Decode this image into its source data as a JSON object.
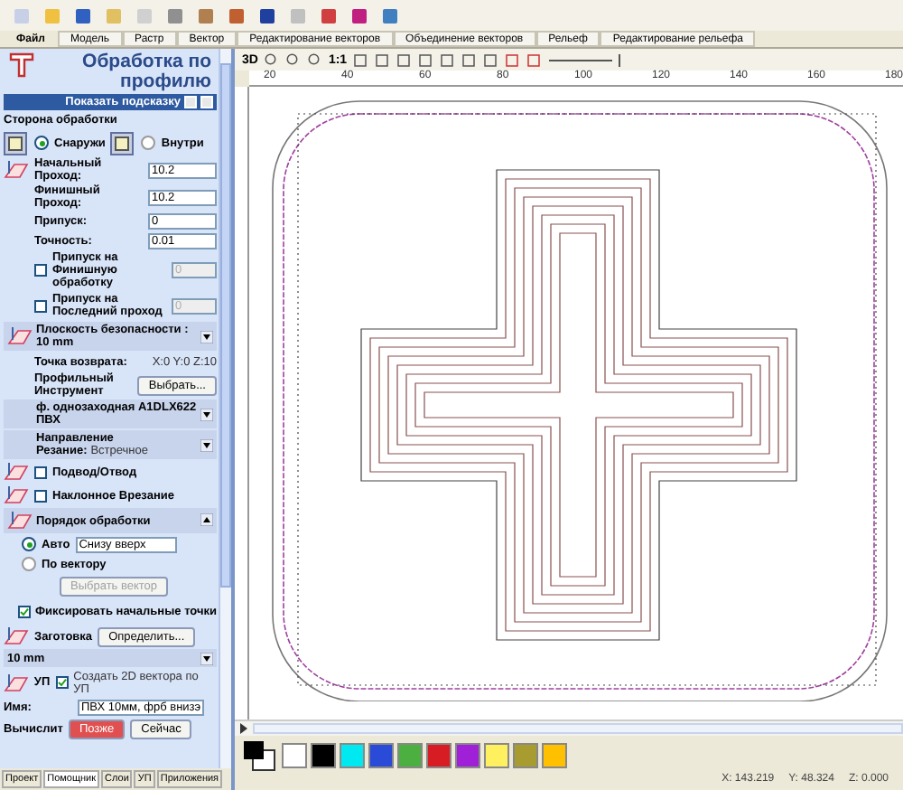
{
  "menu_tabs": [
    {
      "label": "Файл",
      "selected": true
    },
    {
      "label": "Модель",
      "selected": false
    },
    {
      "label": "Растр",
      "selected": false
    },
    {
      "label": "Вектор",
      "selected": false
    },
    {
      "label": "Редактирование векторов",
      "selected": false
    },
    {
      "label": "Объединение векторов",
      "selected": false
    },
    {
      "label": "Рельеф",
      "selected": false
    },
    {
      "label": "Редактирование рельефа",
      "selected": false
    }
  ],
  "panel": {
    "title": "Обработка по профилю",
    "hint_bar": "Показать подсказку",
    "side": {
      "label": "Сторона обработки",
      "options": [
        {
          "label": "Снаружи",
          "selected": true
        },
        {
          "label": "Внутри",
          "selected": false
        }
      ]
    },
    "fields": [
      {
        "label": "Начальный Проход:",
        "value": "10.2"
      },
      {
        "label": "Финишный Проход:",
        "value": "10.2"
      },
      {
        "label": "Припуск:",
        "value": "0"
      },
      {
        "label": "Точность:",
        "value": "0.01"
      }
    ],
    "allowances": [
      {
        "label": "Припуск на Финишную обработку",
        "checked": false,
        "value": "0"
      },
      {
        "label": "Припуск на Последний проход",
        "checked": false,
        "value": "0"
      }
    ],
    "safe_z": "Плоскость безопасности : 10 mm",
    "home": {
      "label": "Точка возврата:",
      "value": "X:0 Y:0 Z:10"
    },
    "tool": {
      "label": "Профильный Инструмент",
      "button": "Выбрать...",
      "name": "ф. однозаходная A1DLX622 ПВХ"
    },
    "direction": {
      "label": "Направление",
      "value_label": "Резание:",
      "value": "Встречное"
    },
    "options": [
      {
        "label": "Подвод/Отвод",
        "checked": false
      },
      {
        "label": "Наклонное Врезание",
        "checked": false
      }
    ],
    "order": {
      "label": "Порядок обработки",
      "expanded": true,
      "modes": [
        {
          "label": "Авто",
          "selected": true
        },
        {
          "label": "По вектору",
          "selected": false
        }
      ],
      "select": "Снизу вверх",
      "vector_button": "Выбрать вектор",
      "fix": {
        "label": "Фиксировать начальные точки",
        "checked": true
      }
    },
    "stock": {
      "label": "Заготовка",
      "button": "Определить...",
      "value": "10 mm"
    },
    "toolpath": {
      "label": "УП",
      "create": {
        "label": "Создать 2D вектора по УП",
        "checked": true
      },
      "name_label": "Имя:",
      "name": "ПВХ 10мм, фрб внизэ",
      "calc_label": "Вычислит",
      "buttons": [
        {
          "label": "Позже",
          "kind": "primary"
        },
        {
          "label": "Сейчас",
          "kind": "normal"
        }
      ]
    }
  },
  "panel_tabs": [
    {
      "label": "Проект",
      "selected": false
    },
    {
      "label": "Помощник",
      "selected": true
    },
    {
      "label": "Слои",
      "selected": false
    },
    {
      "label": "УП",
      "selected": false
    },
    {
      "label": "Приложения",
      "selected": false
    }
  ],
  "view_toolbar": {
    "mode_label": "3D",
    "scale_label": "1:1"
  },
  "ruler": {
    "labels": [
      "20",
      "40",
      "60",
      "80",
      "100",
      "120",
      "140",
      "160",
      "180"
    ]
  },
  "palette": {
    "swatches": [
      {
        "color": "#ffffff"
      },
      {
        "color": "#000000"
      },
      {
        "color": "#00e8f0"
      },
      {
        "color": "#2a4ad8"
      },
      {
        "color": "#4cb040"
      },
      {
        "color": "#d81c24"
      },
      {
        "color": "#a020d8"
      },
      {
        "color": "#fff060"
      },
      {
        "color": "#a89c30"
      },
      {
        "color": "#ffc000"
      }
    ]
  },
  "status_bar": {
    "x": "X: 143.219",
    "y": "Y: 48.324",
    "z": "Z: 0.000"
  }
}
